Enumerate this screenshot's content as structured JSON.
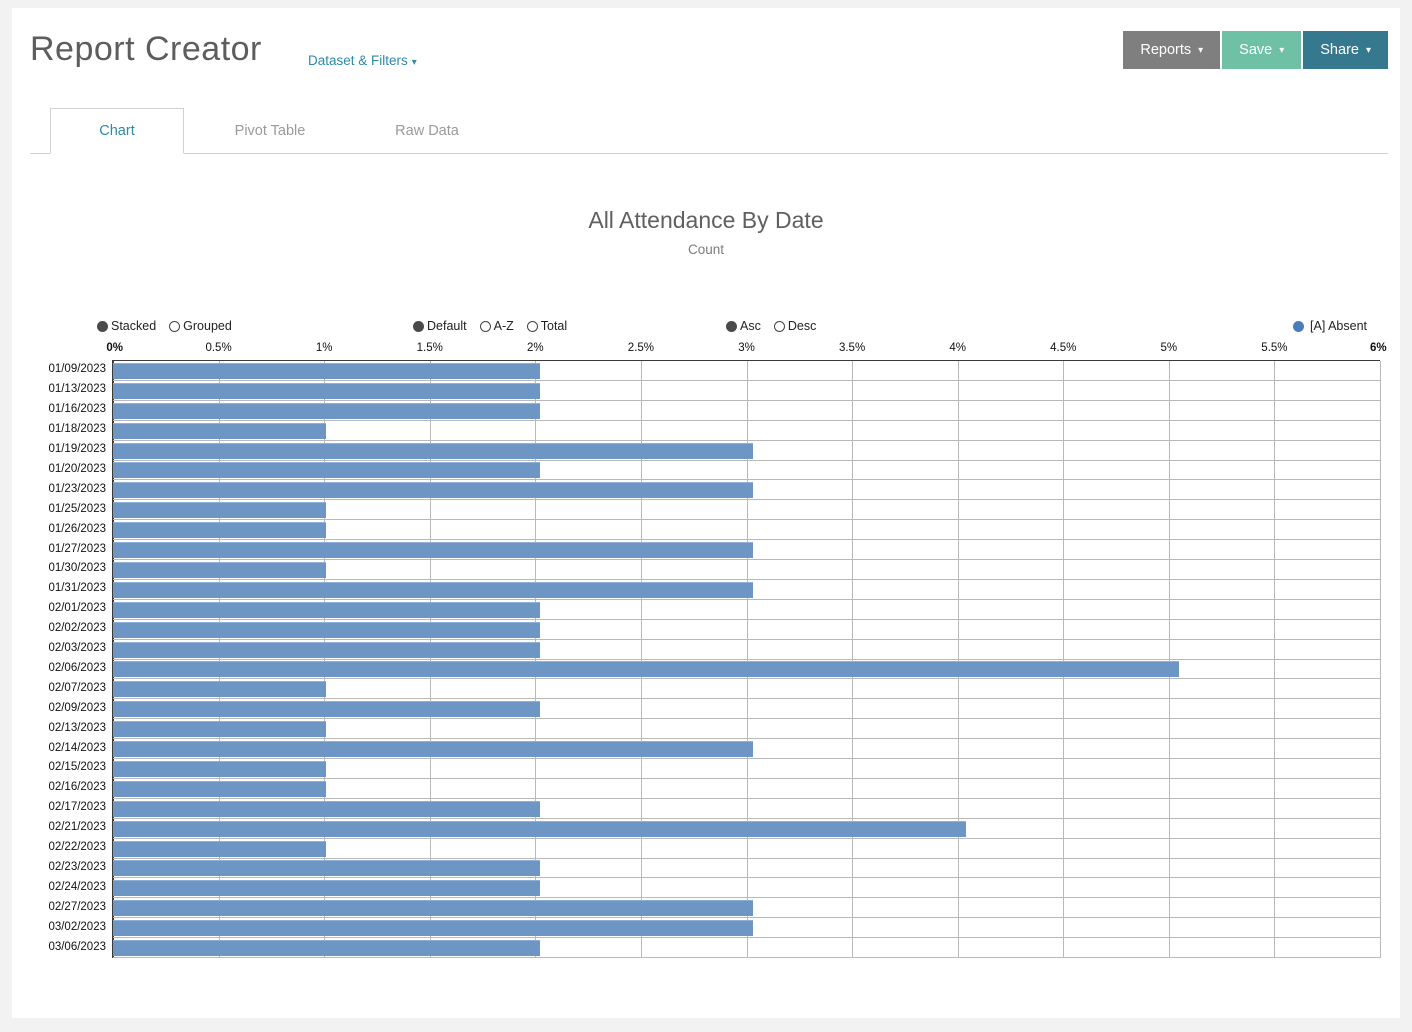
{
  "header": {
    "title": "Report Creator",
    "dataset_filters_label": "Dataset & Filters",
    "caret": "⌄",
    "buttons": [
      {
        "label": "Reports",
        "color": "#7f7f7f"
      },
      {
        "label": "Save",
        "color": "#6fc1a5"
      },
      {
        "label": "Share",
        "color": "#36798f"
      }
    ]
  },
  "tabs": [
    {
      "label": "Chart",
      "active": true
    },
    {
      "label": "Pivot Table",
      "active": false
    },
    {
      "label": "Raw Data",
      "active": false
    }
  ],
  "controls": {
    "group_layout": [
      {
        "label": "Stacked",
        "selected": true
      },
      {
        "label": "Grouped",
        "selected": false
      }
    ],
    "group_sortmode": [
      {
        "label": "Default",
        "selected": true
      },
      {
        "label": "A-Z",
        "selected": false
      },
      {
        "label": "Total",
        "selected": false
      }
    ],
    "group_direction": [
      {
        "label": "Asc",
        "selected": true
      },
      {
        "label": "Desc",
        "selected": false
      }
    ]
  },
  "legend": [
    {
      "label": "[A] Absent",
      "color": "#4a7ebb"
    }
  ],
  "chart_data": {
    "type": "bar",
    "orientation": "horizontal",
    "title": "All Attendance By Date",
    "subtitle": "Count",
    "xlabel": "",
    "ylabel": "",
    "xlim": [
      0,
      6
    ],
    "xunit": "%",
    "grid": true,
    "legend_position": "top-right",
    "tick_labels": [
      "0%",
      "0.5%",
      "1%",
      "1.5%",
      "2%",
      "2.5%",
      "3%",
      "3.5%",
      "4%",
      "4.5%",
      "5%",
      "5.5%",
      "6%"
    ],
    "tick_values": [
      0,
      0.5,
      1,
      1.5,
      2,
      2.5,
      3,
      3.5,
      4,
      4.5,
      5,
      5.5,
      6
    ],
    "categories": [
      "01/09/2023",
      "01/13/2023",
      "01/16/2023",
      "01/18/2023",
      "01/19/2023",
      "01/20/2023",
      "01/23/2023",
      "01/25/2023",
      "01/26/2023",
      "01/27/2023",
      "01/30/2023",
      "01/31/2023",
      "02/01/2023",
      "02/02/2023",
      "02/03/2023",
      "02/06/2023",
      "02/07/2023",
      "02/09/2023",
      "02/13/2023",
      "02/14/2023",
      "02/15/2023",
      "02/16/2023",
      "02/17/2023",
      "02/21/2023",
      "02/22/2023",
      "02/23/2023",
      "02/24/2023",
      "02/27/2023",
      "03/02/2023",
      "03/06/2023"
    ],
    "series": [
      {
        "name": "[A] Absent",
        "color": "#6d96c5",
        "values": [
          2.02,
          2.02,
          2.02,
          1.01,
          3.03,
          2.02,
          3.03,
          1.01,
          1.01,
          3.03,
          1.01,
          3.03,
          2.02,
          2.02,
          2.02,
          5.05,
          1.01,
          2.02,
          1.01,
          3.03,
          1.01,
          1.01,
          2.02,
          4.04,
          1.01,
          2.02,
          2.02,
          3.03,
          3.03,
          2.02
        ]
      }
    ]
  }
}
